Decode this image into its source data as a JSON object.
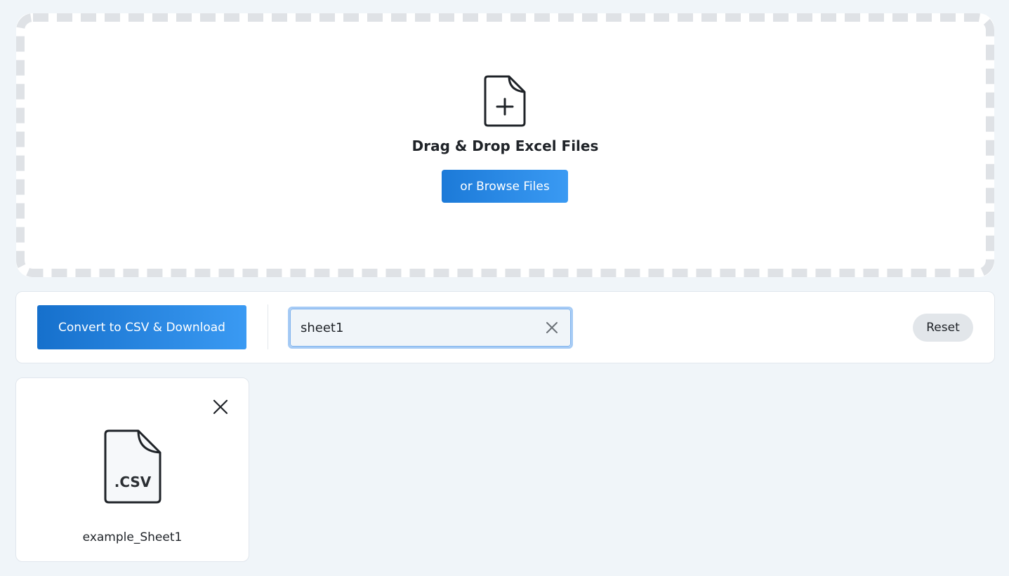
{
  "dropzone": {
    "title": "Drag & Drop Excel Files",
    "browse_label": "or Browse Files",
    "icon": "file-plus-icon"
  },
  "toolbar": {
    "convert_label": "Convert to CSV & Download",
    "search": {
      "value": "sheet1",
      "placeholder": ""
    },
    "reset_label": "Reset"
  },
  "files": [
    {
      "name": "example_Sheet1",
      "extension_label": ".CSV",
      "icon": "csv-file-icon"
    }
  ],
  "colors": {
    "accent": "#2b8ae6",
    "page_bg": "#f0f5f9",
    "dash": "#dfe2e6"
  }
}
